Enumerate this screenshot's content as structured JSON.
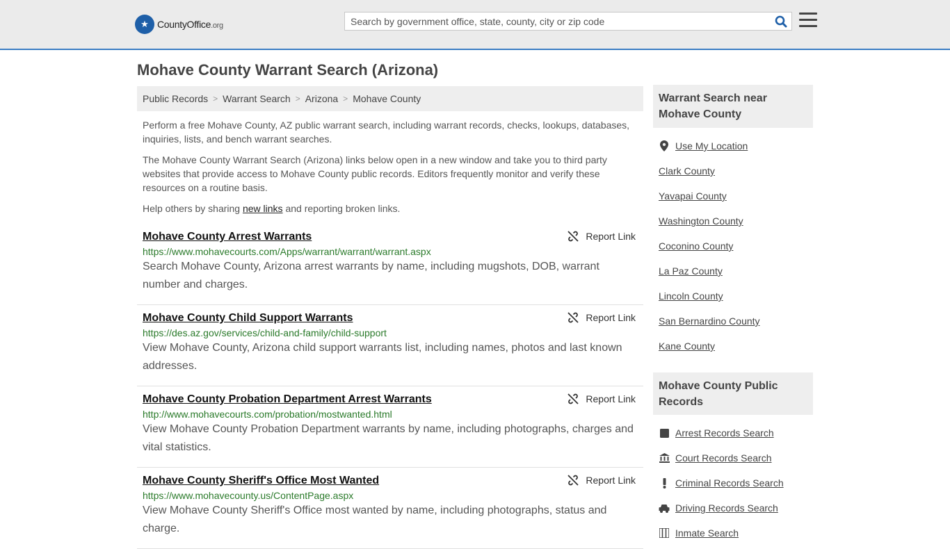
{
  "header": {
    "logo_main": "CountyOffice",
    "logo_tld": ".org",
    "search_placeholder": "Search by government office, state, county, city or zip code"
  },
  "page": {
    "title": "Mohave County Warrant Search (Arizona)"
  },
  "breadcrumb": [
    "Public Records",
    "Warrant Search",
    "Arizona",
    "Mohave County"
  ],
  "intro": {
    "p1": "Perform a free Mohave County, AZ public warrant search, including warrant records, checks, lookups, databases, inquiries, lists, and bench warrant searches.",
    "p2": "The Mohave County Warrant Search (Arizona) links below open in a new window and take you to third party websites that provide access to Mohave County public records. Editors frequently monitor and verify these resources on a routine basis.",
    "p3_before": "Help others by sharing ",
    "p3_link": "new links",
    "p3_after": " and reporting broken links."
  },
  "report_label": "Report Link",
  "results": [
    {
      "title": "Mohave County Arrest Warrants",
      "url": "https://www.mohavecourts.com/Apps/warrant/warrant/warrant.aspx",
      "desc": "Search Mohave County, Arizona arrest warrants by name, including mugshots, DOB, warrant number and charges."
    },
    {
      "title": "Mohave County Child Support Warrants",
      "url": "https://des.az.gov/services/child-and-family/child-support",
      "desc": "View Mohave County, Arizona child support warrants list, including names, photos and last known addresses."
    },
    {
      "title": "Mohave County Probation Department Arrest Warrants",
      "url": "http://www.mohavecourts.com/probation/mostwanted.html",
      "desc": "View Mohave County Probation Department warrants by name, including photographs, charges and vital statistics."
    },
    {
      "title": "Mohave County Sheriff's Office Most Wanted",
      "url": "https://www.mohavecounty.us/ContentPage.aspx",
      "desc": "View Mohave County Sheriff's Office most wanted by name, including photographs, status and charge."
    }
  ],
  "sidebar": {
    "nearby_heading": "Warrant Search near Mohave County",
    "use_location": "Use My Location",
    "nearby": [
      "Clark County",
      "Yavapai County",
      "Washington County",
      "Coconino County",
      "La Paz County",
      "Lincoln County",
      "San Bernardino County",
      "Kane County"
    ],
    "records_heading": "Mohave County Public Records",
    "records": [
      {
        "label": "Arrest Records Search",
        "icon": "square-icon"
      },
      {
        "label": "Court Records Search",
        "icon": "courthouse-icon"
      },
      {
        "label": "Criminal Records Search",
        "icon": "exclamation-icon"
      },
      {
        "label": "Driving Records Search",
        "icon": "car-icon"
      },
      {
        "label": "Inmate Search",
        "icon": "inmate-icon"
      }
    ]
  },
  "colors": {
    "brand_blue": "#1e5fa8",
    "header_bg": "#ebebeb",
    "url_green": "#2a7a2a"
  }
}
